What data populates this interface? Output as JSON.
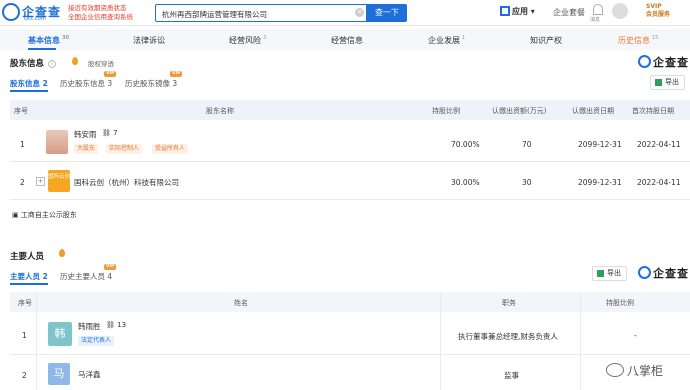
{
  "header": {
    "logo_text": "企查查",
    "logo_sub": "Qcc.com",
    "slogan_line1": "接近有效期资质状态",
    "slogan_line2": "全国企业信用查询系统",
    "search_value": "杭州再西部牌运营管理有限公司",
    "search_button": "查一下",
    "apps_label": "应用",
    "package_label": "企业套餐",
    "bell_label": "消息",
    "vip_line1": "SVIP",
    "vip_line2": "会员服务"
  },
  "tabs": [
    {
      "label": "基本信息",
      "count": "30"
    },
    {
      "label": "法律诉讼",
      "count": ""
    },
    {
      "label": "经营风险",
      "count": "3"
    },
    {
      "label": "经营信息",
      "count": ""
    },
    {
      "label": "企业发展",
      "count": "1"
    },
    {
      "label": "知识产权",
      "count": ""
    },
    {
      "label": "历史信息",
      "count": "15"
    }
  ],
  "shareholders": {
    "title": "股东信息",
    "info_icon": "i",
    "small_link": "股权穿透",
    "subtabs": [
      {
        "label": "股东信息",
        "count": "2"
      },
      {
        "label": "历史股东信息",
        "count": "3"
      },
      {
        "label": "历史股东镜像",
        "count": "3"
      }
    ],
    "vip_tag": "VIP",
    "brand": "企查查",
    "export": "导出",
    "columns": [
      "序号",
      "股东名称",
      "持股比例",
      "认缴出资额(万元)",
      "认缴出资日期",
      "首次持股日期"
    ],
    "rows": [
      {
        "index": "1",
        "name": "韩安雨",
        "link_count": "7",
        "tags": [
          "大股东",
          "实际控制人",
          "受益所有人"
        ],
        "ratio": "70.00%",
        "capital": "70",
        "date": "2099-12-31",
        "first_date": "2022-04-11"
      },
      {
        "index": "2",
        "avatar_text": "国科云创",
        "name": "国科云创（杭州）科技有限公司",
        "ratio": "30.00%",
        "capital": "30",
        "date": "2099-12-31",
        "first_date": "2022-04-11"
      }
    ],
    "footer_link": "工商自主公示股东"
  },
  "personnel": {
    "title": "主要人员",
    "subtabs": [
      {
        "label": "主要人员",
        "count": "2"
      },
      {
        "label": "历史主要人员",
        "count": "4"
      }
    ],
    "vip_tag": "VIP",
    "brand": "企查查",
    "export": "导出",
    "columns": [
      "序号",
      "姓名",
      "职务",
      "持股比例"
    ],
    "rows": [
      {
        "index": "1",
        "avatar": "韩",
        "name": "韩雨胜",
        "link_count": "13",
        "tag": "法定代表人",
        "role": "执行董事兼总经理,财务负责人",
        "ratio": "-"
      },
      {
        "index": "2",
        "avatar": "马",
        "name": "马洋鑫",
        "role": "监事",
        "ratio": "-"
      }
    ]
  },
  "watermark": "八掌柜",
  "colors": {
    "accent": "#1e6fd9",
    "orange": "#f07830",
    "table_header": "#eef3fb"
  }
}
